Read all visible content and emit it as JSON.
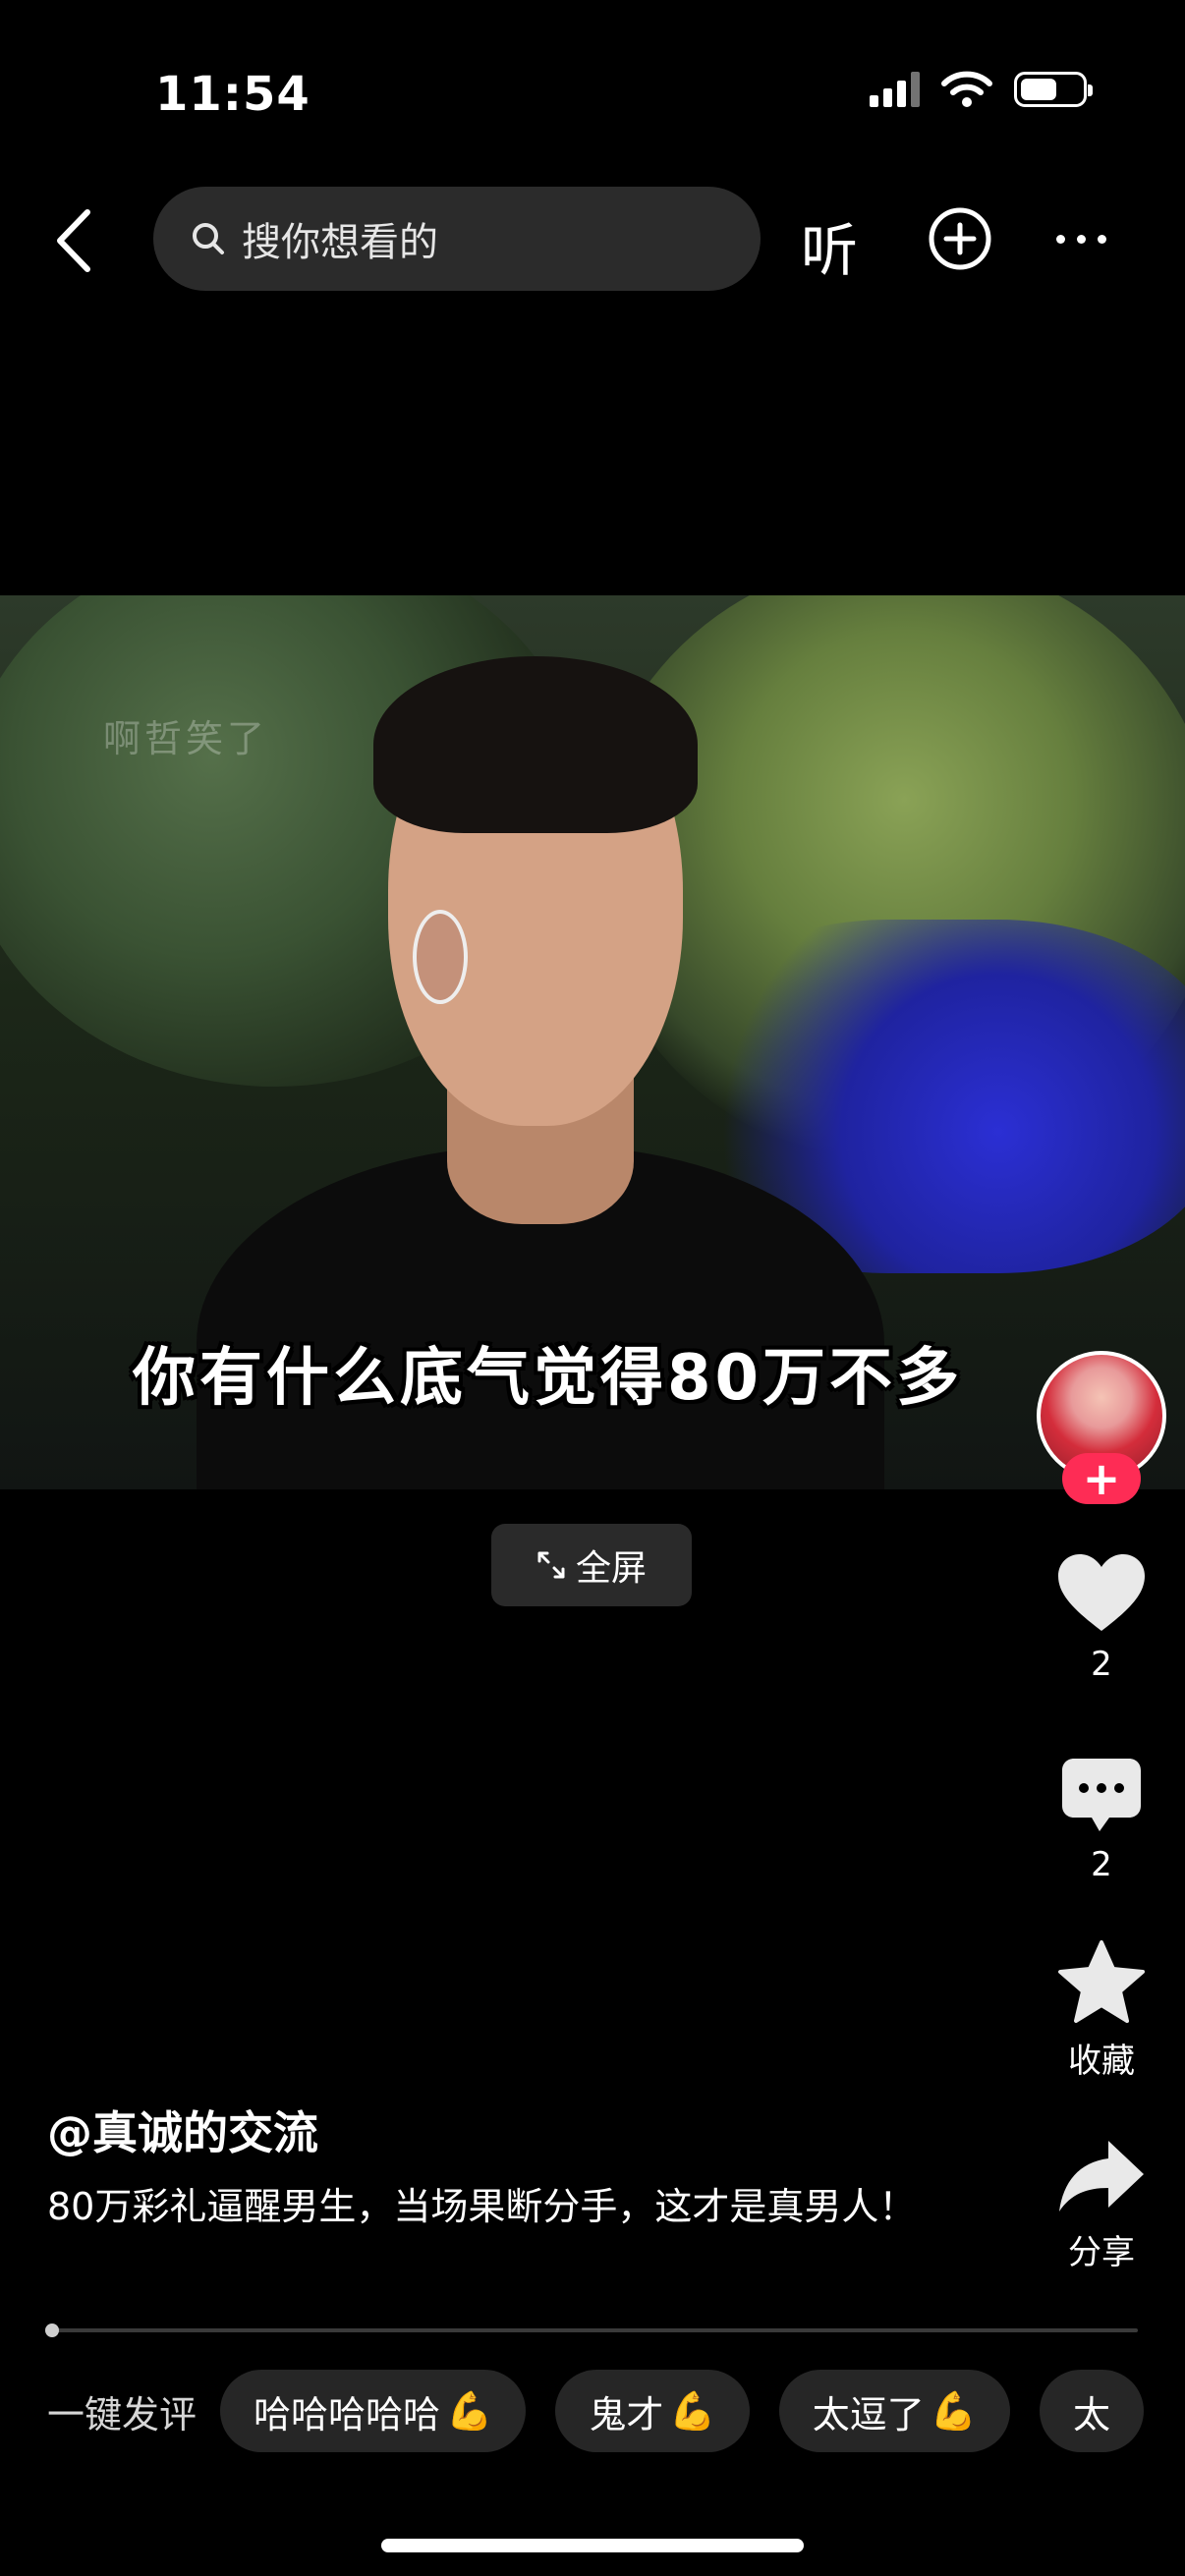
{
  "status_bar": {
    "time": "11:54",
    "battery_level": 0.6
  },
  "top_nav": {
    "search_placeholder": "搜你想看的",
    "listen_label": "听"
  },
  "video": {
    "watermark": "啊哲笑了",
    "subtitle": "你有什么底气觉得80万不多",
    "fullscreen_label": "全屏"
  },
  "rail": {
    "follow_label": "+",
    "likes": "2",
    "comments": "2",
    "favorite_label": "收藏",
    "share_label": "分享"
  },
  "post": {
    "author": "@真诚的交流",
    "description": "80万彩礼逼醒男生，当场果断分手，这才是真男人！"
  },
  "progress": {
    "played_fraction": 0.005
  },
  "quick_comments": {
    "label": "一键发评",
    "chips": [
      {
        "text": "哈哈哈哈哈",
        "emoji": "💪"
      },
      {
        "text": "鬼才",
        "emoji": "💪"
      },
      {
        "text": "太逗了",
        "emoji": "💪"
      },
      {
        "text": "太",
        "emoji": ""
      }
    ]
  },
  "colors": {
    "follow_red": "#fe2c55",
    "chip_bg": "#262626",
    "search_bg": "#2b2b2b"
  }
}
